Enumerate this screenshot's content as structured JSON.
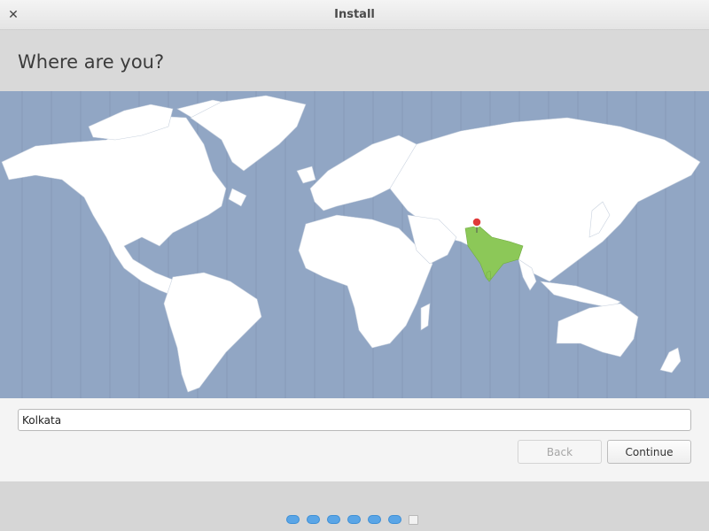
{
  "window": {
    "title": "Install",
    "close_icon": "close-icon"
  },
  "header": {
    "title": "Where are you?"
  },
  "map": {
    "selected_region": "India",
    "colors": {
      "ocean": "#91a6c4",
      "land": "#ffffff",
      "selected": "#8cc858",
      "marker": "#e03a3a"
    }
  },
  "location": {
    "value": "Kolkata"
  },
  "buttons": {
    "back": "Back",
    "continue": "Continue"
  },
  "progress": {
    "completed_steps": 6,
    "total_steps": 7,
    "current_step": 7
  }
}
